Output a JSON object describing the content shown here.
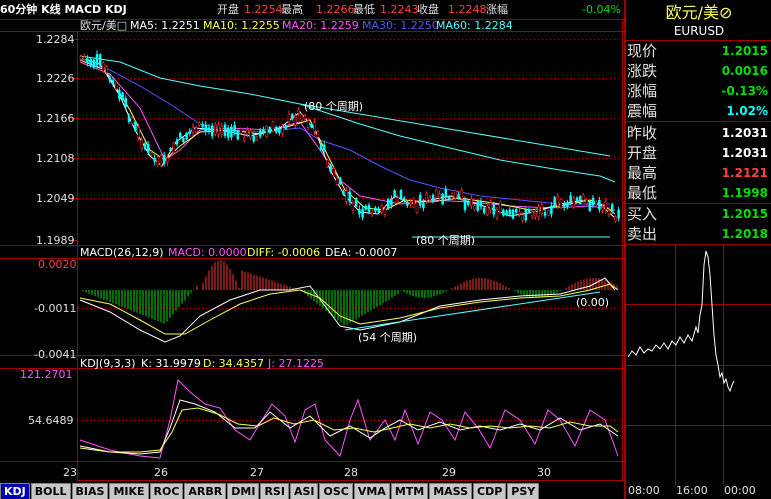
{
  "header": {
    "title": "60分钟 K线 MACD KDJ",
    "open_label": "开盘",
    "open_value": "1.2254",
    "high_label": "最高",
    "high_value": "1.2266",
    "low_label": "最低",
    "low_value": "1.2243",
    "close_label": "收盘",
    "close_value": "1.2248",
    "change_label": "涨幅",
    "change_value": "-0.04%"
  },
  "main_chart": {
    "ma_title": "欧元/美□",
    "ma5": "MA5: 1.2251",
    "ma10": "MA10: 1.2255",
    "ma20": "MA20: 1.2259",
    "ma30": "MA30: 1.2250",
    "ma60": "MA60: 1.2284",
    "y_ticks": [
      "1.2284",
      "1.2226",
      "1.2166",
      "1.2108",
      "1.2049",
      "1.1989"
    ],
    "annotation_80": "(80 个周期)",
    "annotation_80_bottom": "(80 个周期)"
  },
  "macd_chart": {
    "label": "MACD(26,12,9)",
    "macd": "MACD: 0.0000",
    "diff": "DIFF: -0.0006",
    "dea": "DEA: -0.0007",
    "y_ticks": [
      "0.0020",
      "-0.0011",
      "-0.0041"
    ],
    "annotation_54": "(54 个周期)",
    "annotation_zero": "(0.00)"
  },
  "kdj_chart": {
    "label": "KDJ(9,3,3)",
    "k": "K: 31.9979",
    "d": "D: 34.4357",
    "j": "J: 27.1225",
    "y_ticks": [
      "121.2701",
      "54.6489"
    ]
  },
  "x_axis": [
    "23",
    "26",
    "27",
    "28",
    "29",
    "30"
  ],
  "tabs": [
    "KDJ",
    "BOLL",
    "BIAS",
    "MIKE",
    "ROC",
    "ARBR",
    "DMI",
    "RSI",
    "ASI",
    "OSC",
    "VMA",
    "MTM",
    "MASS",
    "CDP",
    "PSY"
  ],
  "right_panel": {
    "title": "欧元/美⊘",
    "symbol": "EURUSD",
    "rows": [
      {
        "label": "现价",
        "value": "1.2015",
        "color": "#00e000"
      },
      {
        "label": "涨跌",
        "value": "0.0016",
        "color": "#00e000"
      },
      {
        "label": "涨幅",
        "value": "-0.13%",
        "color": "#00e000"
      },
      {
        "label": "震幅",
        "value": "1.02%",
        "color": "#00ffff"
      },
      {
        "label": "昨收",
        "value": "1.2031",
        "color": "#ffffff"
      },
      {
        "label": "开盘",
        "value": "1.2031",
        "color": "#ffffff"
      },
      {
        "label": "最高",
        "value": "1.2121",
        "color": "#ff4040"
      },
      {
        "label": "最低",
        "value": "1.1998",
        "color": "#00e000"
      },
      {
        "label": "买入",
        "value": "1.2015",
        "color": "#00e000"
      },
      {
        "label": "卖出",
        "value": "1.2018",
        "color": "#00e000"
      }
    ],
    "time_ticks": [
      "08:00",
      "16:00",
      "00:00"
    ]
  },
  "colors": {
    "grid": "#a00000",
    "up": "#ff3030",
    "down": "#00ffff",
    "ma5": "#ffffff",
    "ma10": "#ffff54",
    "ma20": "#ff54ff",
    "ma30": "#5454ff",
    "ma60": "#54ffff"
  }
}
